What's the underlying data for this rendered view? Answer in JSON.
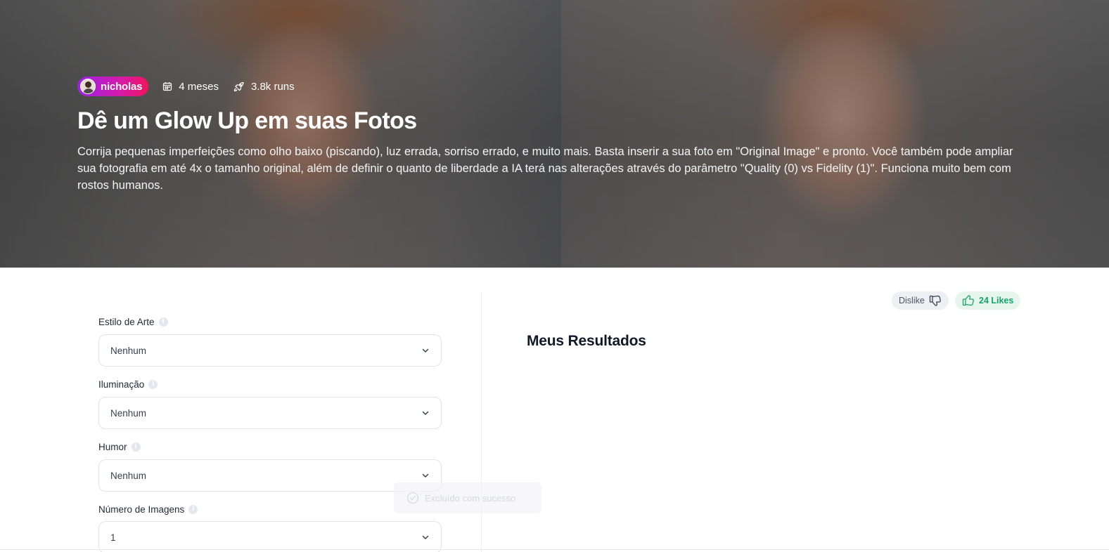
{
  "hero": {
    "author": "nicholas",
    "age": "4 meses",
    "runs": "3.8k runs",
    "title": "Dê um Glow Up em suas Fotos",
    "description": "Corrija pequenas imperfeições como olho baixo (piscando), luz errada, sorriso errado, e muito mais. Basta inserir a sua foto em \"Original Image\" e pronto. Você também pode ampliar sua fotografia em até 4x o tamanho original, além de definir o quanto de liberdade a IA terá nas alterações através do parâmetro \"Quality (0) vs Fidelity (1)\". Funciona muito bem com rostos humanos."
  },
  "form": {
    "fields": [
      {
        "label": "Estilo de Arte",
        "value": "Nenhum"
      },
      {
        "label": "Iluminação",
        "value": "Nenhum"
      },
      {
        "label": "Humor",
        "value": "Nenhum"
      },
      {
        "label": "Número de Imagens",
        "value": "1"
      }
    ],
    "info_icon": "i"
  },
  "results": {
    "title": "Meus Resultados",
    "dislike_label": "Dislike",
    "like_label": "24 Likes"
  },
  "toast": {
    "message": "Excluído com sucesso"
  },
  "icons": {
    "calendar": "calendar-icon",
    "rocket": "rocket-icon",
    "thumbs_down": "thumbs-down-icon",
    "thumbs_up": "thumbs-up-icon",
    "chevron": "chevron-down-icon",
    "check": "check-circle-icon",
    "info": "info-icon"
  },
  "colors": {
    "author_gradient_start": "#9b22e8",
    "author_gradient_end": "#f0155e",
    "like_green": "#16a36a",
    "like_bg": "#e6f6ee"
  }
}
